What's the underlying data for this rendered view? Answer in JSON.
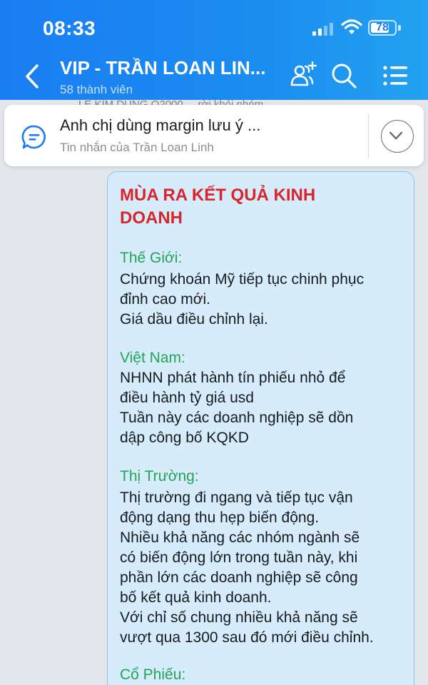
{
  "status_bar": {
    "time": "08:33",
    "battery": "78",
    "battery_level": 0.78
  },
  "header": {
    "title": "VIP - TRẦN LOAN LIN...",
    "subtitle": "58 thành viên",
    "icons": [
      "back-icon",
      "add-member-icon",
      "search-icon",
      "menu-icon"
    ]
  },
  "behind_text": "LÊ KIM DUNG Q2000 ... rời khỏi nhóm.",
  "pinned": {
    "title": "Anh chị dùng margin lưu ý ...",
    "subtitle": "Tin nhắn của Trần Loan Linh"
  },
  "message": {
    "title_lines": [
      "MÙA RA KẾT QUẢ KINH",
      "DOANH"
    ],
    "sections": [
      {
        "heading": "Thế Giới:",
        "lines": [
          "Chứng khoán Mỹ tiếp tục chinh phục",
          "đỉnh cao mới.",
          "Giá dầu điều chỉnh lại."
        ]
      },
      {
        "heading": "Việt Nam:",
        "lines": [
          "NHNN phát hành tín phiếu nhỏ để",
          "điều hành tỷ giá usd",
          "Tuần này các doanh nghiệp sẽ dồn",
          "dập công bố KQKD"
        ]
      },
      {
        "heading": "Thị Trường:",
        "lines": [
          "Thị trường đi ngang và tiếp tục vận",
          "động dạng thu hẹp biến động.",
          "Nhiều khả năng các nhóm ngành sẽ",
          "có biến động lớn trong tuần này, khi",
          "phần lớn các doanh nghiệp sẽ công",
          "bố kết quả kinh doanh.",
          "Với chỉ số chung nhiều khả năng sẽ",
          "vượt qua 1300 sau đó mới điều chỉnh."
        ]
      },
      {
        "heading": "Cổ Phiếu:",
        "lines": []
      }
    ]
  }
}
